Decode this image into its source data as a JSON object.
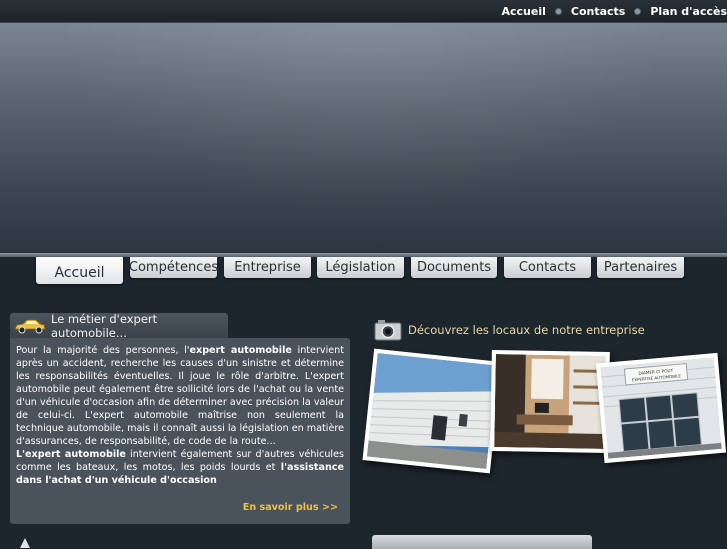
{
  "top_links": [
    "Accueil",
    "Contacts",
    "Plan d'accès"
  ],
  "nav": {
    "tabs": [
      "Accueil",
      "Compétences",
      "Entreprise",
      "Législation",
      "Documents",
      "Contacts",
      "Partenaires"
    ],
    "active": "Accueil"
  },
  "metier": {
    "title": "Le métier d'expert automobile...",
    "p1_a": "Pour la majorité des personnes, l'",
    "p1_b": "expert automobile",
    "p1_c": " intervient après un accident, recherche les causes d'un sinistre et détermine les responsabilités éventuelles. Il joue le rôle d'arbitre. L'expert automobile peut également être sollicité lors de l'achat ou la vente d'un véhicule d'occasion afin de déterminer avec précision la valeur de celui-ci. L'expert automobile maîtrise non seulement la technique automobile, mais il connaît aussi la législation en matière d'assurances, de responsabilité, de code de la route...",
    "p2_a": "L'expert automobile",
    "p2_b": " intervient également sur d'autres véhicules comme les bateaux, les motos, les poids lourds et ",
    "p2_c": "l'assistance dans l'achat d'un véhicule d'occasion",
    "more": "En savoir plus >>"
  },
  "locaux": {
    "title": "Découvrez les locaux de notre entreprise",
    "sign_line1": "DIAMER CI POUT",
    "sign_line2": "EXPERTISE AUTOMOBILE"
  },
  "icons": {
    "car": "car-icon",
    "camera": "camera-icon"
  },
  "colors": {
    "accent_link": "#f0c040",
    "background": "#1d252d",
    "panel": "#4a535b"
  }
}
